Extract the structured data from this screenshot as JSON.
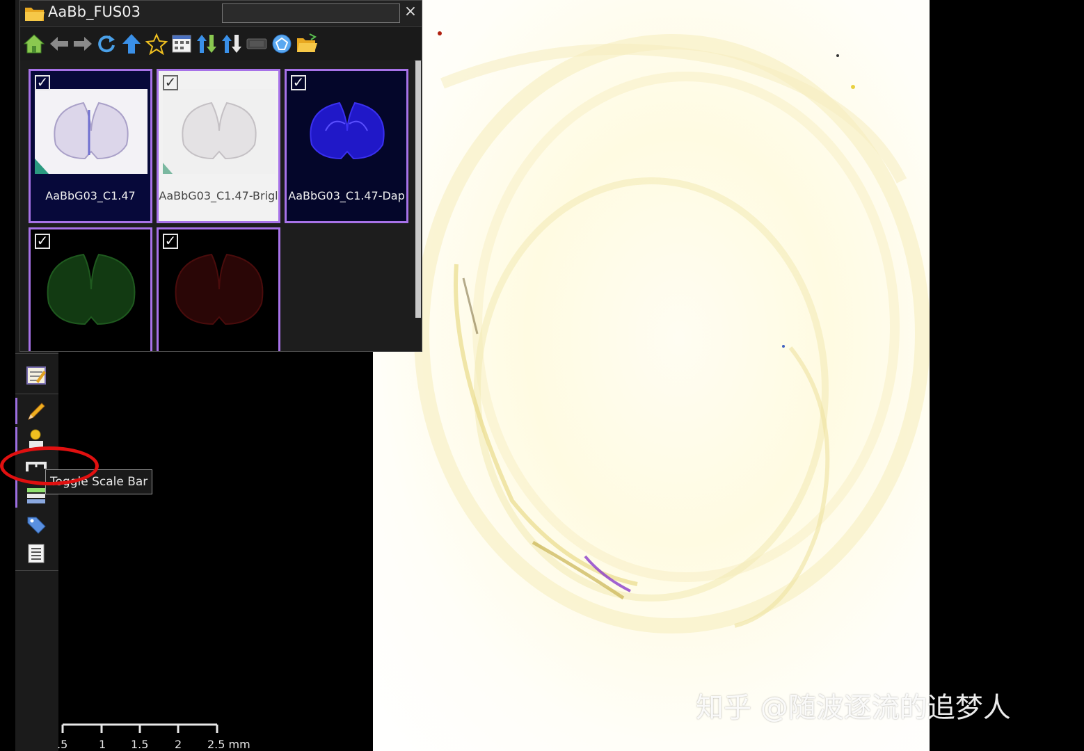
{
  "folder_window": {
    "title": "AaBb_FUS03",
    "search_value": "",
    "close_label": "×",
    "toolbar_icons": [
      "home-icon",
      "back-icon",
      "forward-icon",
      "refresh-icon",
      "up-icon",
      "favorite-icon",
      "grid-view-icon",
      "sort-asc-icon",
      "sort-desc-icon",
      "slide-icon",
      "network-icon",
      "open-folder-icon"
    ],
    "thumbnails": [
      {
        "label": "AaBbG03_C1.47",
        "checked": "✓",
        "style": "overview"
      },
      {
        "label": "AaBbG03_C1.47-Brigl",
        "checked": "✓",
        "style": "bright"
      },
      {
        "label": "AaBbG03_C1.47-Dap",
        "checked": "✓",
        "style": "dapi"
      },
      {
        "label": "",
        "checked": "✓",
        "style": "green"
      },
      {
        "label": "",
        "checked": "✓",
        "style": "red"
      }
    ]
  },
  "tooltip": {
    "text": "Toggle Scale Bar"
  },
  "left_toolbar": {
    "icons": [
      "annotation-note-icon",
      "pencil-icon",
      "marker-pin-icon",
      "scale-bar-icon",
      "color-bars-icon",
      "tag-icon",
      "list-icon"
    ]
  },
  "scale_bar": {
    "ticks": [
      ".5",
      "1",
      "1.5",
      "2",
      "2.5 mm"
    ]
  },
  "watermark": {
    "text": "知乎 @随波逐流的追梦人"
  },
  "colors": {
    "selection_border": "#a772e8",
    "annotation_red": "#e01010",
    "viewer_bg": "#fffbe2"
  }
}
